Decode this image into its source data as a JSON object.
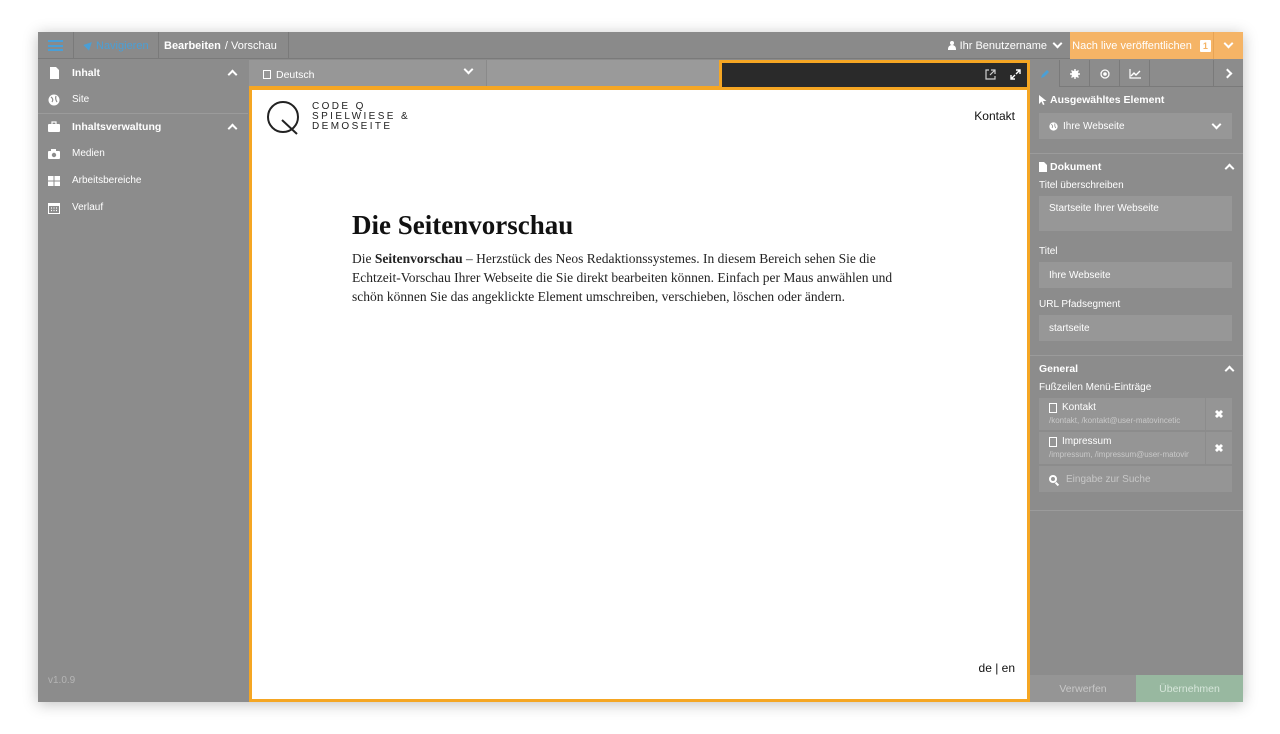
{
  "topbar": {
    "nav_label": "Navigieren",
    "crumb_bold": "Bearbeiten",
    "crumb_rest": "/ Vorschau",
    "user_label": "Ihr Benutzername",
    "publish_label": "Nach live veröffentlichen",
    "publish_count": "1",
    "accent_color": "#f5b466",
    "link_color": "#4a9fd6"
  },
  "sidebar": {
    "group1": "Inhalt",
    "items1": [
      {
        "label": "Site",
        "icon": "globe-icon"
      }
    ],
    "group2": "Inhaltsverwaltung",
    "items2": [
      {
        "label": "Medien",
        "icon": "camera-icon"
      },
      {
        "label": "Arbeitsbereiche",
        "icon": "grid-icon"
      },
      {
        "label": "Verlauf",
        "icon": "calendar-icon"
      }
    ],
    "version": "v1.0.9"
  },
  "language": {
    "selected": "Deutsch"
  },
  "preview": {
    "frame_color": "#f5a623",
    "logo_line1": "CODE Q",
    "logo_line2": "SPIELWIESE &",
    "logo_line3": "DEMOSEITE",
    "kontakt": "Kontakt",
    "title": "Die Seitenvorschau",
    "body_bold": "Seitenvorschau",
    "body_pre": "Die ",
    "body_post": " – Herzstück des Neos Redaktionssystemes. In diesem Bereich sehen Sie die Echtzeit-Vorschau Ihrer Webseite die Sie direkt bearbeiten können. Einfach per Maus anwählen und schön können Sie das angeklickte Element umschreiben, verschieben, löschen oder ändern.",
    "lang_switch": "de | en"
  },
  "inspector": {
    "selected_heading": "Ausgewähltes Element",
    "selected_value": "Ihre Webseite",
    "doc_heading": "Dokument",
    "label_title_override": "Titel überschreiben",
    "value_title_override": "Startseite Ihrer Webseite",
    "label_title": "Titel",
    "value_title": "Ihre Webseite",
    "label_url": "URL Pfadsegment",
    "value_url": "startseite",
    "general_heading": "General",
    "label_footer": "Fußzeilen Menü-Einträge",
    "refs": [
      {
        "title": "Kontakt",
        "sub": "/kontakt, /kontakt@user-matovincetic"
      },
      {
        "title": "Impressum",
        "sub": "/impressum, /impressum@user-matovincetic"
      }
    ],
    "search_placeholder": "Eingabe zur Suche",
    "discard": "Verwerfen",
    "apply": "Übernehmen"
  }
}
